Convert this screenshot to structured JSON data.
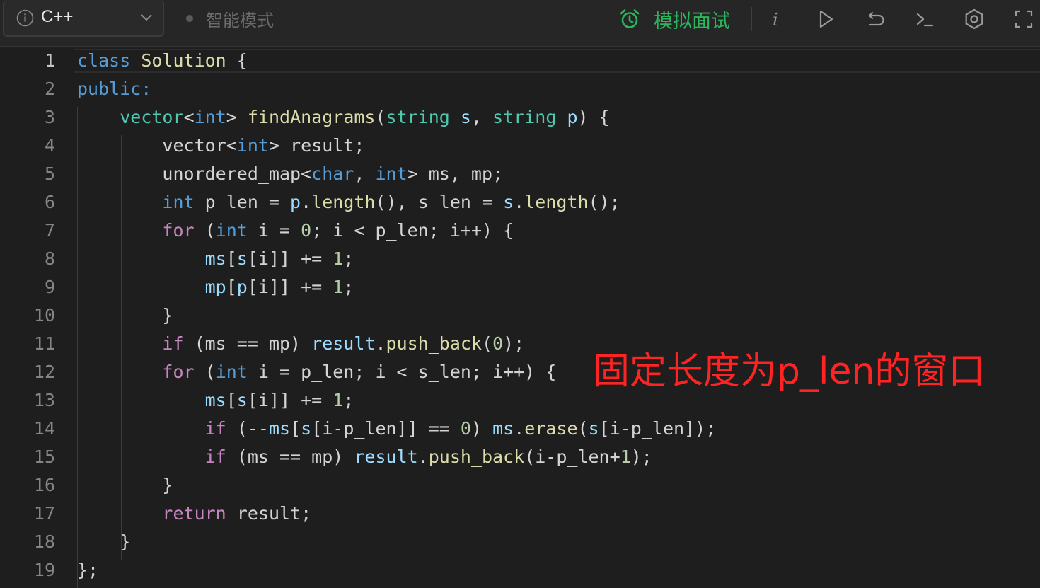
{
  "toolbar": {
    "language": "C++",
    "mode_label": "智能模式",
    "interview_label": "模拟面试",
    "icons": [
      "info-icon",
      "chevron-down-icon",
      "alarm-clock-icon",
      "italic-info-icon",
      "run-icon",
      "reset-icon",
      "console-icon",
      "settings-icon",
      "fullscreen-icon"
    ],
    "accent_color": "#2db55d"
  },
  "editor": {
    "line_numbers": [
      "1",
      "2",
      "3",
      "4",
      "5",
      "6",
      "7",
      "8",
      "9",
      "10",
      "11",
      "12",
      "13",
      "14",
      "15",
      "16",
      "17",
      "18",
      "19"
    ],
    "lines": [
      [
        [
          "class",
          "k-blue"
        ],
        [
          " ",
          "k-plain"
        ],
        [
          "Solution",
          "k-fn"
        ],
        [
          " {",
          "k-plain"
        ]
      ],
      [
        [
          "public:",
          "k-blue"
        ]
      ],
      [
        [
          "    ",
          "k-plain"
        ],
        [
          "vector",
          "k-type"
        ],
        [
          "<",
          "k-plain"
        ],
        [
          "int",
          "k-blue"
        ],
        [
          "> ",
          "k-plain"
        ],
        [
          "findAnagrams",
          "k-fn"
        ],
        [
          "(",
          "k-plain"
        ],
        [
          "string",
          "k-type"
        ],
        [
          " ",
          "k-plain"
        ],
        [
          "s",
          "k-var"
        ],
        [
          ", ",
          "k-plain"
        ],
        [
          "string",
          "k-type"
        ],
        [
          " ",
          "k-plain"
        ],
        [
          "p",
          "k-var"
        ],
        [
          ") {",
          "k-plain"
        ]
      ],
      [
        [
          "        vector<",
          "k-plain"
        ],
        [
          "int",
          "k-blue"
        ],
        [
          "> result;",
          "k-plain"
        ]
      ],
      [
        [
          "        unordered_map<",
          "k-plain"
        ],
        [
          "char",
          "k-blue"
        ],
        [
          ", ",
          "k-plain"
        ],
        [
          "int",
          "k-blue"
        ],
        [
          "> ms, mp;",
          "k-plain"
        ]
      ],
      [
        [
          "        ",
          "k-plain"
        ],
        [
          "int",
          "k-blue"
        ],
        [
          " p_len = ",
          "k-plain"
        ],
        [
          "p",
          "k-var"
        ],
        [
          ".",
          "k-plain"
        ],
        [
          "length",
          "k-fn"
        ],
        [
          "(), s_len = ",
          "k-plain"
        ],
        [
          "s",
          "k-var"
        ],
        [
          ".",
          "k-plain"
        ],
        [
          "length",
          "k-fn"
        ],
        [
          "();",
          "k-plain"
        ]
      ],
      [
        [
          "        ",
          "k-plain"
        ],
        [
          "for",
          "k-ctrl"
        ],
        [
          " (",
          "k-plain"
        ],
        [
          "int",
          "k-blue"
        ],
        [
          " i = ",
          "k-plain"
        ],
        [
          "0",
          "k-num"
        ],
        [
          "; i < p_len; i++) {",
          "k-plain"
        ]
      ],
      [
        [
          "            ",
          "k-plain"
        ],
        [
          "ms",
          "k-var"
        ],
        [
          "[",
          "k-plain"
        ],
        [
          "s",
          "k-var"
        ],
        [
          "[i]] += ",
          "k-plain"
        ],
        [
          "1",
          "k-num"
        ],
        [
          ";",
          "k-plain"
        ]
      ],
      [
        [
          "            ",
          "k-plain"
        ],
        [
          "mp",
          "k-var"
        ],
        [
          "[",
          "k-plain"
        ],
        [
          "p",
          "k-var"
        ],
        [
          "[i]] += ",
          "k-plain"
        ],
        [
          "1",
          "k-num"
        ],
        [
          ";",
          "k-plain"
        ]
      ],
      [
        [
          "        }",
          "k-plain"
        ]
      ],
      [
        [
          "        ",
          "k-plain"
        ],
        [
          "if",
          "k-ctrl"
        ],
        [
          " (ms == mp) ",
          "k-plain"
        ],
        [
          "result",
          "k-var"
        ],
        [
          ".",
          "k-plain"
        ],
        [
          "push_back",
          "k-fn"
        ],
        [
          "(",
          "k-plain"
        ],
        [
          "0",
          "k-num"
        ],
        [
          ");",
          "k-plain"
        ]
      ],
      [
        [
          "        ",
          "k-plain"
        ],
        [
          "for",
          "k-ctrl"
        ],
        [
          " (",
          "k-plain"
        ],
        [
          "int",
          "k-blue"
        ],
        [
          " i = p_len; i < s_len; i++) {",
          "k-plain"
        ]
      ],
      [
        [
          "            ",
          "k-plain"
        ],
        [
          "ms",
          "k-var"
        ],
        [
          "[",
          "k-plain"
        ],
        [
          "s",
          "k-var"
        ],
        [
          "[i]] += ",
          "k-plain"
        ],
        [
          "1",
          "k-num"
        ],
        [
          ";",
          "k-plain"
        ]
      ],
      [
        [
          "            ",
          "k-plain"
        ],
        [
          "if",
          "k-ctrl"
        ],
        [
          " (--",
          "k-plain"
        ],
        [
          "ms",
          "k-var"
        ],
        [
          "[",
          "k-plain"
        ],
        [
          "s",
          "k-var"
        ],
        [
          "[i-p_len]] == ",
          "k-plain"
        ],
        [
          "0",
          "k-num"
        ],
        [
          ") ",
          "k-plain"
        ],
        [
          "ms",
          "k-var"
        ],
        [
          ".",
          "k-plain"
        ],
        [
          "erase",
          "k-fn"
        ],
        [
          "(",
          "k-plain"
        ],
        [
          "s",
          "k-var"
        ],
        [
          "[i-p_len]);",
          "k-plain"
        ]
      ],
      [
        [
          "            ",
          "k-plain"
        ],
        [
          "if",
          "k-ctrl"
        ],
        [
          " (ms == mp) ",
          "k-plain"
        ],
        [
          "result",
          "k-var"
        ],
        [
          ".",
          "k-plain"
        ],
        [
          "push_back",
          "k-fn"
        ],
        [
          "(i-p_len+",
          "k-plain"
        ],
        [
          "1",
          "k-num"
        ],
        [
          ");",
          "k-plain"
        ]
      ],
      [
        [
          "        }",
          "k-plain"
        ]
      ],
      [
        [
          "        ",
          "k-plain"
        ],
        [
          "return",
          "k-ctrl"
        ],
        [
          " result;",
          "k-plain"
        ]
      ],
      [
        [
          "    }",
          "k-plain"
        ]
      ],
      [
        [
          "};",
          "k-plain"
        ]
      ]
    ]
  },
  "annotation": {
    "text": "固定长度为p_len的窗口",
    "color": "#ff2323"
  }
}
